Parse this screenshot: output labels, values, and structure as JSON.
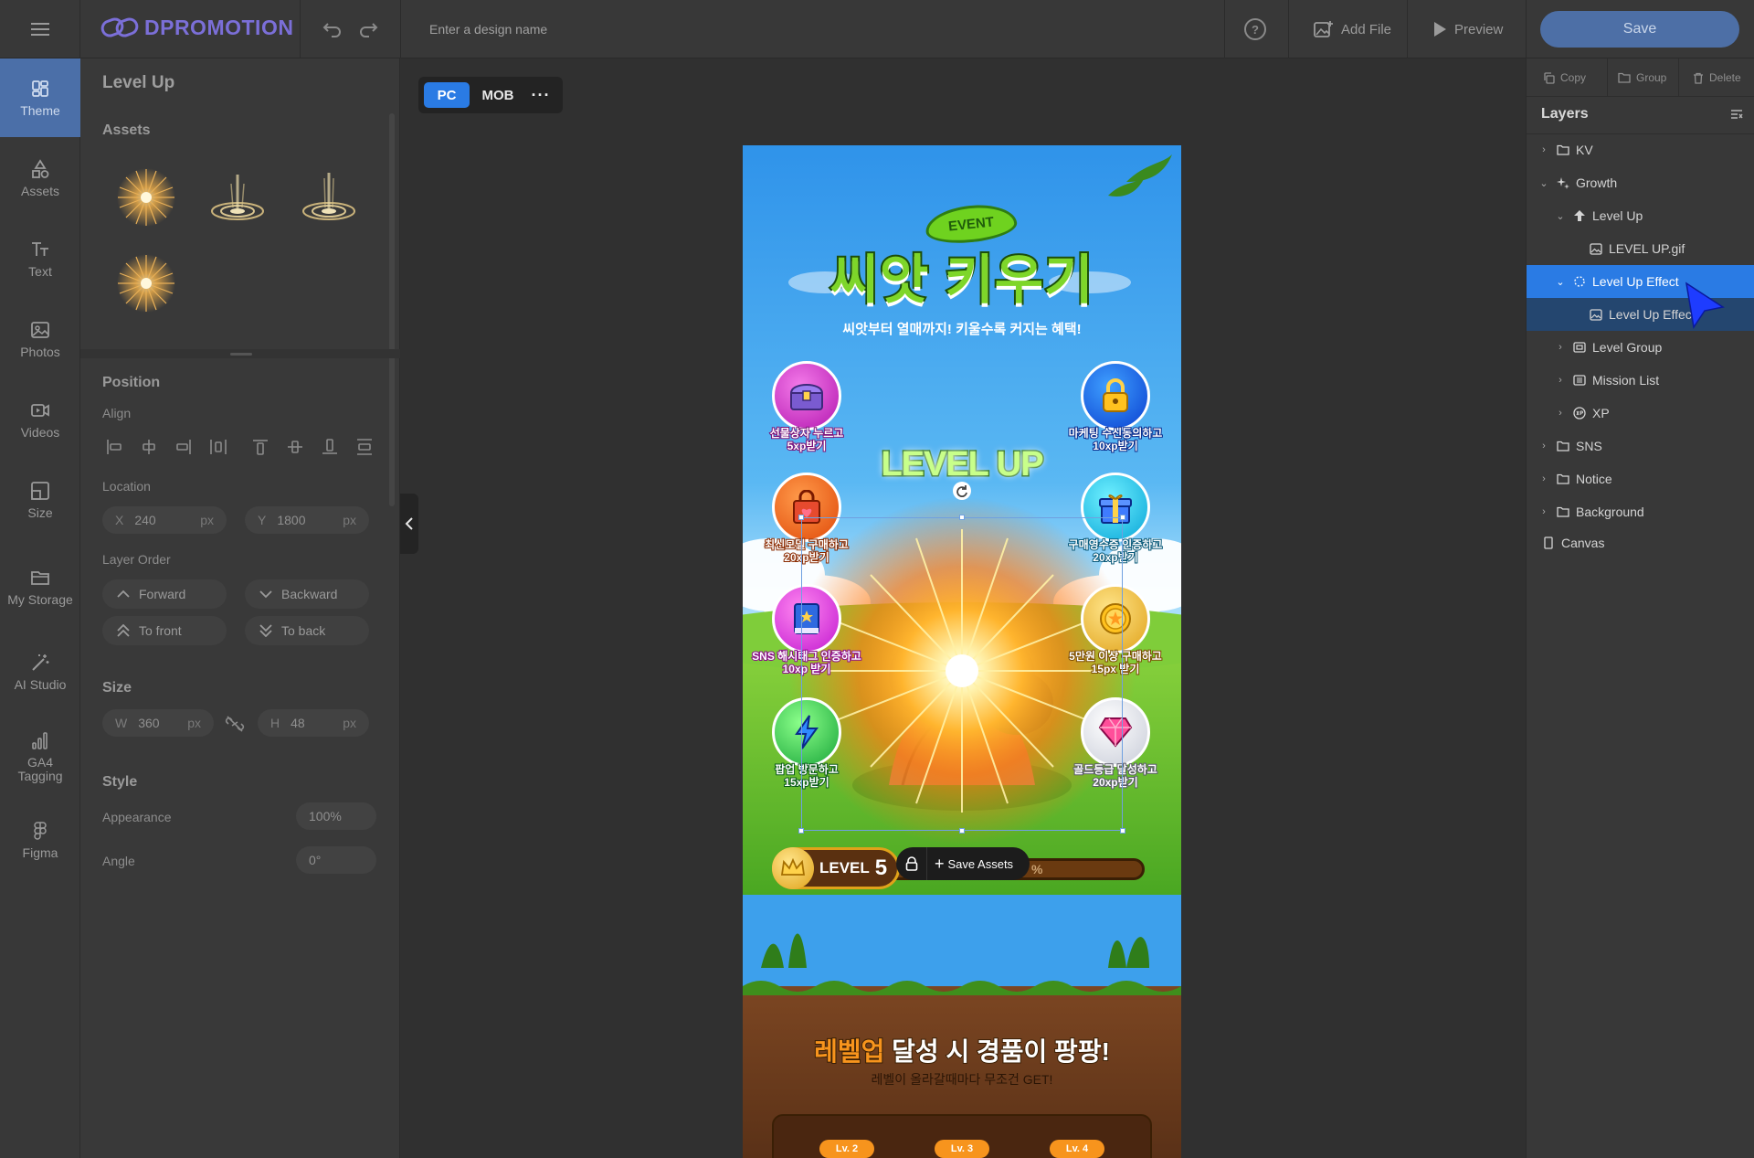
{
  "topbar": {
    "logo": "DPROMOTION",
    "design_name_placeholder": "Enter a design name",
    "add_file_label": "Add File",
    "preview_label": "Preview",
    "save_label": "Save"
  },
  "nav": {
    "items": [
      {
        "label": "Theme",
        "icon": "theme-icon"
      },
      {
        "label": "Assets",
        "icon": "assets-icon"
      },
      {
        "label": "Text",
        "icon": "text-icon"
      },
      {
        "label": "Photos",
        "icon": "photos-icon"
      },
      {
        "label": "Videos",
        "icon": "videos-icon"
      },
      {
        "label": "Size",
        "icon": "size-icon"
      },
      {
        "label": "My Storage",
        "icon": "folder-icon"
      },
      {
        "label": "AI Studio",
        "icon": "magic-wand-icon"
      },
      {
        "label": "GA4 Tagging",
        "icon": "analytics-icon"
      },
      {
        "label": "Figma",
        "icon": "figma-icon"
      }
    ]
  },
  "panel": {
    "title": "Level Up",
    "assets_title": "Assets",
    "position_title": "Position",
    "align_label": "Align",
    "location_label": "Location",
    "x_key": "X",
    "x_value": "240",
    "x_unit": "px",
    "y_key": "Y",
    "y_value": "1800",
    "y_unit": "px",
    "layer_order_label": "Layer Order",
    "forward_label": "Forward",
    "backward_label": "Backward",
    "to_front_label": "To front",
    "to_back_label": "To back",
    "size_title": "Size",
    "w_key": "W",
    "w_value": "360",
    "w_unit": "px",
    "h_key": "H",
    "h_value": "48",
    "h_unit": "px",
    "style_title": "Style",
    "appearance_label": "Appearance",
    "appearance_value": "100%",
    "angle_label": "Angle",
    "angle_value": "0°"
  },
  "device": {
    "pc": "PC",
    "mob": "MOB",
    "more": "···"
  },
  "preview": {
    "event_badge": "EVENT",
    "title": "씨앗 키우기",
    "subtitle": "씨앗부터 열매까지! 키울수록 커지는 혜택!",
    "levelup_text": "LEVEL UP",
    "missions": [
      {
        "line1": "선물상자 누르고",
        "line2": "5xp받기"
      },
      {
        "line1": "마케팅 수신동의하고",
        "line2": "10xp받기"
      },
      {
        "line1": "최신모델 구매하고",
        "line2": "20xp받기"
      },
      {
        "line1": "구매영수증 인증하고",
        "line2": "20xp받기"
      },
      {
        "line1": "SNS 해시태그 인증하고",
        "line2": "10xp 받기"
      },
      {
        "line1": "5만원 이상 구매하고",
        "line2": "15px 받기"
      },
      {
        "line1": "팝업 방문하고",
        "line2": "15xp받기"
      },
      {
        "line1": "골드등급 달성하고",
        "line2": "20xp받기"
      }
    ],
    "level_label": "LEVEL",
    "level_value": "5",
    "progress_tail": "%",
    "save_assets_label": "Save Assets",
    "bottom_title_highlight": "레벨업",
    "bottom_title_rest": " 달성 시 경품이 팡팡!",
    "bottom_subtitle": "레벨이 올라갈때마다 무조건 GET!",
    "tiers": [
      "Lv. 2",
      "Lv. 3",
      "Lv. 4"
    ]
  },
  "rightpanel": {
    "copy_label": "Copy",
    "group_label": "Group",
    "delete_label": "Delete",
    "layers_title": "Layers",
    "layers": [
      {
        "label": "KV"
      },
      {
        "label": "Growth"
      },
      {
        "label": "Level Up"
      },
      {
        "label": "LEVEL UP.gif"
      },
      {
        "label": "Level Up Effect"
      },
      {
        "label": "Level Up Effect"
      },
      {
        "label": "Level Group"
      },
      {
        "label": "Mission List"
      },
      {
        "label": "XP"
      },
      {
        "label": "SNS"
      },
      {
        "label": "Notice"
      },
      {
        "label": "Background"
      },
      {
        "label": "Canvas"
      }
    ]
  },
  "colors": {
    "accent": "#2a7be4",
    "save_button": "#4d6fa6",
    "active_nav": "#4b6fa8",
    "sky": "#3da0ec",
    "grass": "#5fbf2e",
    "soil": "#6e3f1f",
    "title_green": "#6fd21f",
    "highlight_orange": "#f7941d"
  }
}
